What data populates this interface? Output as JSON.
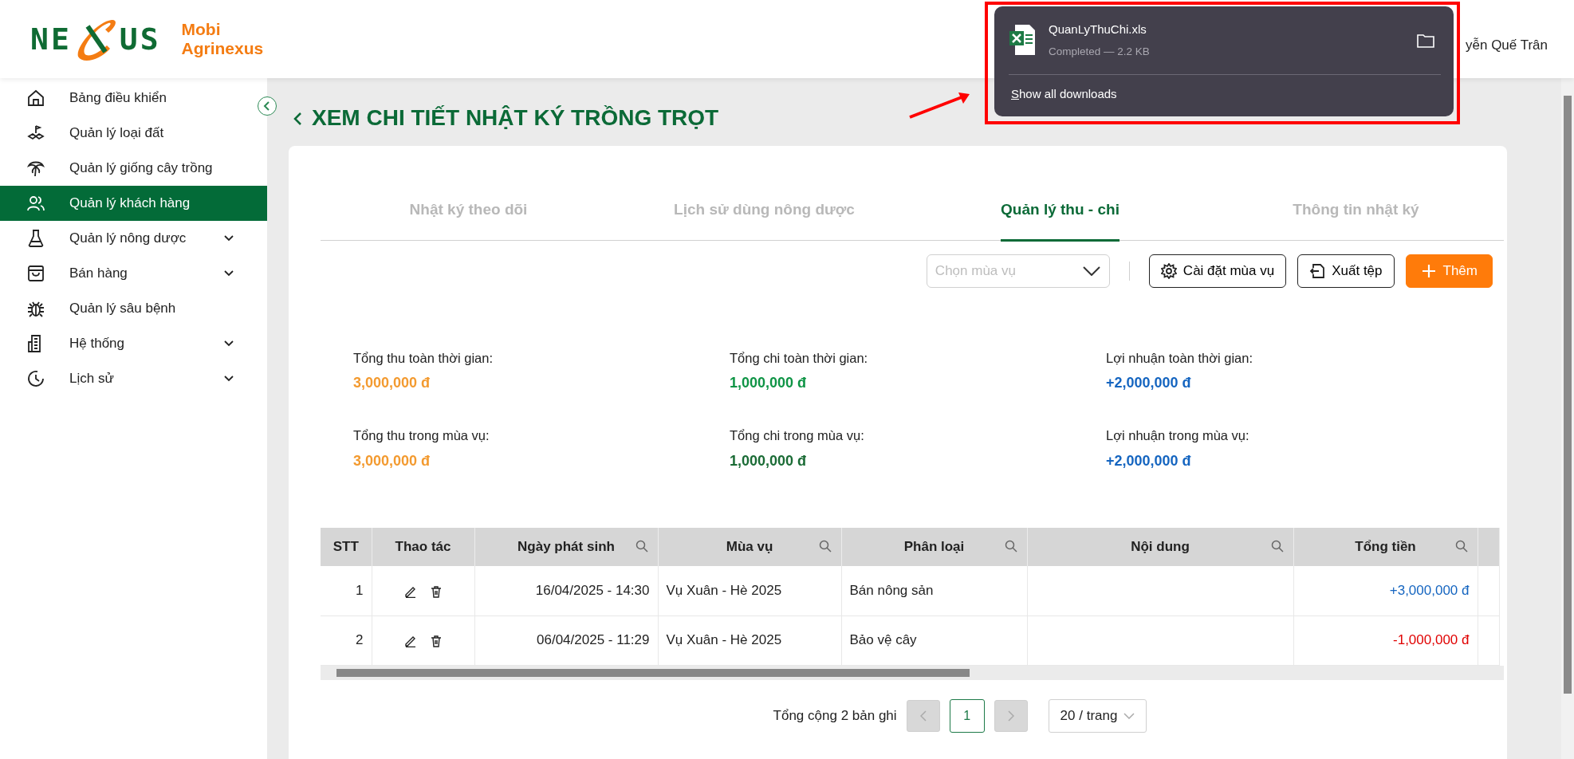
{
  "brand": {
    "logo_left": "NE",
    "logo_right": "US",
    "name_lines": [
      "Mobi",
      "Agrinexus"
    ]
  },
  "user_name": "yễn Quế Trân",
  "sidebar": {
    "items": [
      {
        "label": "Bảng điều khiển",
        "selected": false,
        "expandable": false
      },
      {
        "label": "Quản lý loại đất",
        "selected": false,
        "expandable": false
      },
      {
        "label": "Quản lý giống cây trồng",
        "selected": false,
        "expandable": false
      },
      {
        "label": "Quản lý khách hàng",
        "selected": true,
        "expandable": false
      },
      {
        "label": "Quản lý nông dược",
        "selected": false,
        "expandable": true
      },
      {
        "label": "Bán hàng",
        "selected": false,
        "expandable": true
      },
      {
        "label": "Quản lý sâu bệnh",
        "selected": false,
        "expandable": false
      },
      {
        "label": "Hệ thống",
        "selected": false,
        "expandable": true
      },
      {
        "label": "Lịch sử",
        "selected": false,
        "expandable": true
      }
    ]
  },
  "page_title": "XEM CHI TIẾT NHẬT KÝ TRỒNG TRỌT",
  "tabs": [
    {
      "label": "Nhật ký theo dõi",
      "selected": false
    },
    {
      "label": "Lịch sử dùng nông dược",
      "selected": false
    },
    {
      "label": "Quản lý thu - chi",
      "selected": true
    },
    {
      "label": "Thông tin nhật ký",
      "selected": false
    }
  ],
  "toolbar": {
    "season_select": {
      "placeholder": "Chọn mùa vụ"
    },
    "buttons": [
      {
        "label": "Cài đặt mùa vụ",
        "kind": "settings"
      },
      {
        "label": "Xuất tệp",
        "kind": "export"
      },
      {
        "label": "Thêm",
        "kind": "add"
      }
    ]
  },
  "summary": [
    {
      "label": "Tổng thu toàn thời gian:",
      "value": "3,000,000 đ",
      "color": "#f39a2f"
    },
    {
      "label": "Tổng chi toàn thời gian:",
      "value": "1,000,000 đ",
      "color": "#0e9445"
    },
    {
      "label": "Lợi nhuận toàn thời gian:",
      "value": "+2,000,000 đ",
      "color": "#1565c0"
    },
    {
      "label": "Tổng thu trong mùa vụ:",
      "value": "3,000,000 đ",
      "color": "#f39a2f"
    },
    {
      "label": "Tổng chi trong mùa vụ:",
      "value": "1,000,000 đ",
      "color": "#1a6b35"
    },
    {
      "label": "Lợi nhuận trong mùa vụ:",
      "value": "+2,000,000 đ",
      "color": "#1565c0"
    }
  ],
  "table": {
    "columns": [
      {
        "label": "STT",
        "searchable": false
      },
      {
        "label": "Thao tác",
        "searchable": false
      },
      {
        "label": "Ngày phát sinh",
        "searchable": true
      },
      {
        "label": "Mùa vụ",
        "searchable": true
      },
      {
        "label": "Phân loại",
        "searchable": true
      },
      {
        "label": "Nội dung",
        "searchable": true
      },
      {
        "label": "Tổng tiền",
        "searchable": true
      }
    ],
    "rows": [
      {
        "index": "1",
        "date": "16/04/2025 - 14:30",
        "season": "Vụ Xuân - Hè 2025",
        "category": "Bán nông sản",
        "content": "",
        "amount": "+3,000,000 đ",
        "color": "#1565c0"
      },
      {
        "index": "2",
        "date": "06/04/2025 - 11:29",
        "season": "Vụ Xuân - Hè 2025",
        "category": "Bảo vệ cây",
        "content": "",
        "amount": "-1,000,000 đ",
        "color": "#e00000"
      }
    ]
  },
  "pagination": {
    "total": "Tổng cộng 2 bản ghi",
    "pages": [
      {
        "label": "1",
        "selected": true
      }
    ],
    "page_size": "20 / trang"
  },
  "download_popup": {
    "file_name": "QuanLyThuChi.xls",
    "status": "Completed — 2.2 KB",
    "link": "Show all downloads"
  }
}
